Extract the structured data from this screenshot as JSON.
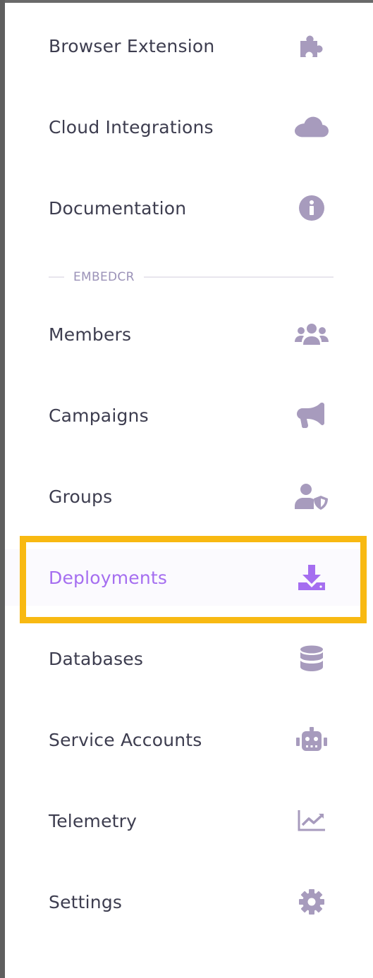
{
  "nav": {
    "top_items": [
      {
        "label": "Browser Extension",
        "icon": "puzzle-icon"
      },
      {
        "label": "Cloud Integrations",
        "icon": "cloud-icon"
      },
      {
        "label": "Documentation",
        "icon": "info-circle-icon"
      }
    ],
    "section_label": "EMBEDCR",
    "section_items": [
      {
        "label": "Members",
        "icon": "users-icon"
      },
      {
        "label": "Campaigns",
        "icon": "megaphone-icon"
      },
      {
        "label": "Groups",
        "icon": "user-shield-icon"
      },
      {
        "label": "Deployments",
        "icon": "download-icon",
        "active": true
      },
      {
        "label": "Databases",
        "icon": "database-icon"
      },
      {
        "label": "Service Accounts",
        "icon": "robot-icon"
      },
      {
        "label": "Telemetry",
        "icon": "chart-line-icon"
      },
      {
        "label": "Settings",
        "icon": "gear-icon"
      }
    ]
  },
  "colors": {
    "text": "#3d3d4f",
    "icon": "#a79bbd",
    "active": "#a56ef0",
    "highlight": "#f8b912",
    "section": "#9b92b8"
  }
}
